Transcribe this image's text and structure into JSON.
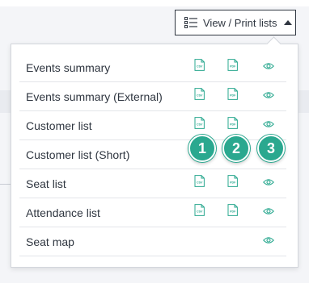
{
  "toolbar": {
    "button_label": "View / Print lists",
    "list_icon": "list-icon",
    "caret_icon": "caret-up-icon"
  },
  "menu": {
    "items": [
      {
        "label": "Events summary",
        "csv": true,
        "pdf": true,
        "view": true
      },
      {
        "label": "Events summary (External)",
        "csv": true,
        "pdf": true,
        "view": true
      },
      {
        "label": "Customer list",
        "csv": true,
        "pdf": true,
        "view": true
      },
      {
        "label": "Customer list (Short)",
        "csv": false,
        "pdf": false,
        "view": false
      },
      {
        "label": "Seat list",
        "csv": true,
        "pdf": true,
        "view": true
      },
      {
        "label": "Attendance list",
        "csv": true,
        "pdf": true,
        "view": true
      },
      {
        "label": "Seat map",
        "csv": false,
        "pdf": false,
        "view": true
      }
    ],
    "csv_icon_text": "CSV",
    "pdf_icon_text": "PDF"
  },
  "badges": [
    "1",
    "2",
    "3"
  ],
  "colors": {
    "accent": "#2aa88f",
    "text": "#2f3640",
    "border": "#d3d6dc"
  }
}
